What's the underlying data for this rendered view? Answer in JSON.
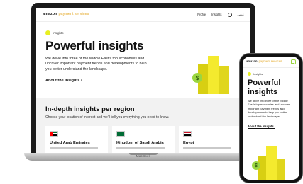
{
  "brand": {
    "name": "amazon",
    "product": "payment services"
  },
  "laptop": {
    "model": "MacBook",
    "nav": {
      "profile": "Profile",
      "insights": "Insights",
      "lang": "عربي"
    },
    "hero": {
      "badge": "Insights",
      "title": "Powerful insights",
      "description": "We delve into three of the Middle East's top economies and uncover important payment trends and developments to help you better understand the landscape.",
      "link": "About the insights ›",
      "coin_symbol": "$"
    },
    "region": {
      "title": "In-depth insights per region",
      "subtitle": "Choose your location of interest and we'll tell you everything you need to know.",
      "cards": [
        {
          "name": "United Arab Emirates"
        },
        {
          "name": "Kingdom of Saudi Arabia"
        },
        {
          "name": "Egypt"
        }
      ]
    }
  },
  "phone": {
    "badge": "Insights",
    "title": "Powerful insights",
    "description": "We delve into three of the Middle East's top economies and uncover important payment trends and developments to help you better understand the landscape.",
    "link": "About the insights ›",
    "coin_symbol": "$"
  },
  "colors": {
    "accent_yellow": "#f4ea2e",
    "accent_green": "#9bd640",
    "brand_orange": "#e4a826"
  }
}
